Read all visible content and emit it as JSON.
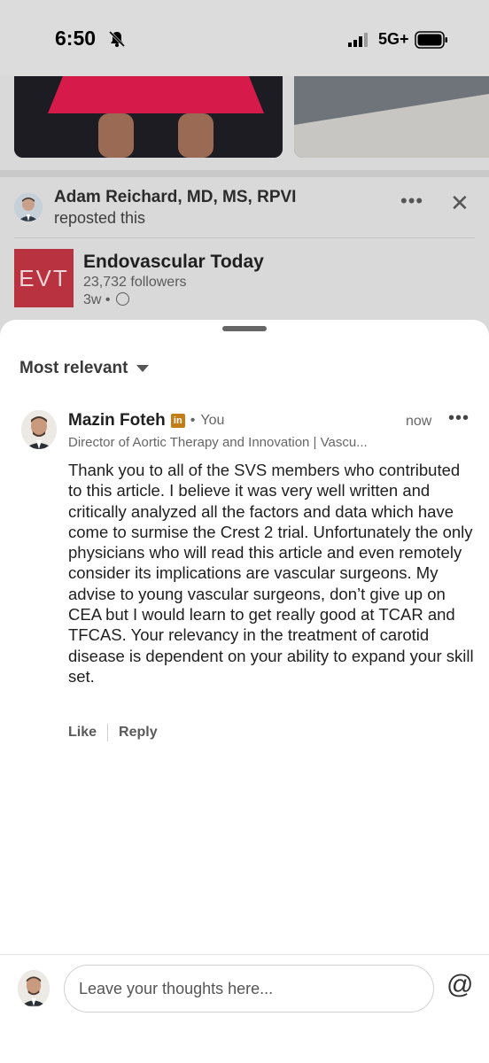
{
  "status_bar": {
    "time": "6:50",
    "network": "5G+",
    "icons": [
      "bell-slash-icon",
      "signal-icon",
      "battery-icon"
    ]
  },
  "repost": {
    "name": "Adam Reichard, MD, MS, RPVI",
    "action": "reposted this",
    "more_glyph": "•••",
    "close_glyph": "✕"
  },
  "page": {
    "logo_text": "EVT",
    "name": "Endovascular Today",
    "followers": "23,732 followers",
    "age": "3w •"
  },
  "sheet": {
    "sort_label": "Most relevant",
    "comment": {
      "author": "Mazin Foteh",
      "badge": "in",
      "separator": "•",
      "you_label": "You",
      "time": "now",
      "more_glyph": "•••",
      "headline": "Director of Aortic Therapy and Innovation | Vascu...",
      "text": "Thank you to all of the SVS members who contributed to this article. I believe it was very well written and critically analyzed all the factors and data which have come to surmise the Crest 2 trial. Unfortunately the only physicians who will read this article and even remotely consider its implications are vascular surgeons. My advise to young vascular surgeons, don’t give up on CEA but I would learn to get really good at TCAR and TFCAS. Your relevancy in the treatment of carotid disease is dependent on your ability to expand your skill set.",
      "like_label": "Like",
      "reply_label": "Reply"
    },
    "composer": {
      "placeholder": "Leave your thoughts here...",
      "mention_glyph": "@"
    }
  },
  "colors": {
    "accent_logo": "#b8323f",
    "linkedin_badge": "#c37d16",
    "sheet_bg": "#ffffff",
    "backdrop": "#d9d9d9"
  }
}
